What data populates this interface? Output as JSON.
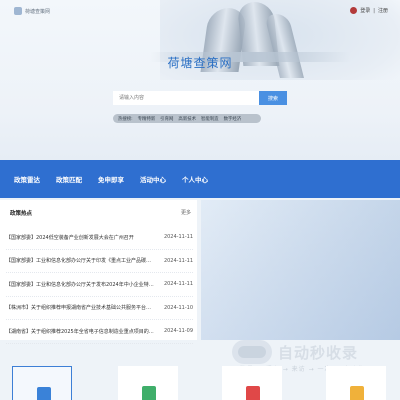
{
  "header": {
    "brand_text": "荷塘查策网",
    "login": "登录",
    "separator": "|",
    "register": "注册"
  },
  "site_title": "荷塘查策网",
  "search": {
    "placeholder": "请输入内容",
    "button_label": "搜索"
  },
  "hot_search": {
    "label": "热搜榜:",
    "items": [
      "专精特新",
      "引育网",
      "高新技术",
      "智能制造",
      "数字经济"
    ]
  },
  "nav": {
    "items": [
      "政策雷达",
      "政策匹配",
      "免申即享",
      "活动中心",
      "个人中心"
    ]
  },
  "news": {
    "title": "政策热点",
    "more": "更多",
    "items": [
      {
        "text": "【国家部委】2024低空装备产业创新发展大会在广州召开",
        "date": "2024-11-11"
      },
      {
        "text": "【国家部委】工业和信息化部办公厅关于印发《重点工业产品碳足迹核算规则》",
        "date": "2024-11-11"
      },
      {
        "text": "【国家部委】工业和信息化部办公厅关于发布2024年中小企业特色产业集群",
        "date": "2024-11-11"
      },
      {
        "text": "【株洲市】关于组织推荐申报湖南省产业技术基础公共服务平台的通知",
        "date": "2024-11-10"
      },
      {
        "text": "【湖南省】关于组织推荐2025年全省电子信息制造业重点项目的通知",
        "date": "2024-11-09"
      }
    ]
  },
  "watermark": {
    "title": "自动秒收录",
    "subtitle": "数量 → 提交 → 来访 → 一次 → 自动收录 →"
  },
  "colors": {
    "primary": "#2f6fd0",
    "search_button": "#4a90e2",
    "title": "#2a6fc4"
  },
  "cards": {
    "icons": [
      "policy-document-icon",
      "shopping-bag-icon",
      "report-icon",
      "calendar-icon"
    ]
  }
}
